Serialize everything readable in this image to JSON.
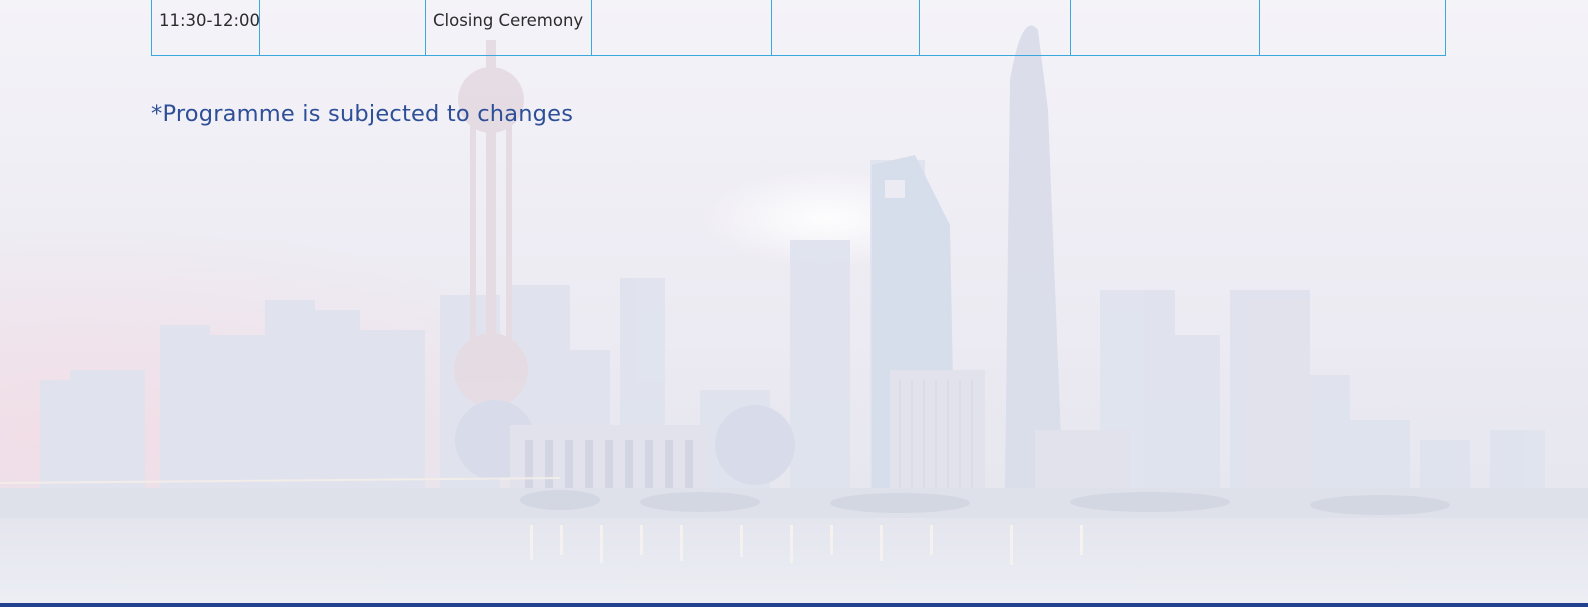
{
  "programme": {
    "rows": [
      {
        "cells": [
          "11:30-12:00",
          "",
          "Closing Ceremony",
          "",
          "",
          "",
          "",
          ""
        ]
      }
    ]
  },
  "note": "*Programme is subjected to changes",
  "colors": {
    "table_border": "#3aa8dc",
    "event_text": "#c2262e",
    "note_text": "#2e4f97",
    "footer_bar": "#22418e"
  },
  "background": {
    "image": "city-skyline-photo"
  }
}
